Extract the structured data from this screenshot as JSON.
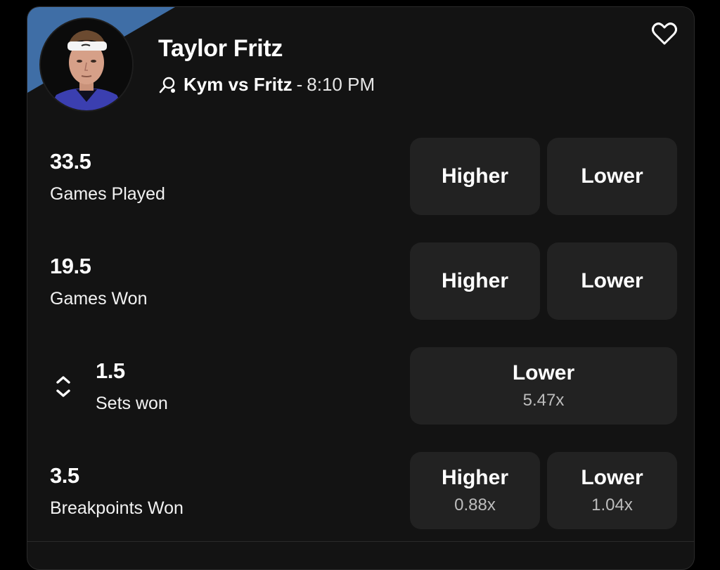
{
  "player": {
    "name": "Taylor Fritz",
    "matchup": "Kym vs Fritz",
    "separator": "-",
    "time": "8:10 PM"
  },
  "colors": {
    "card_bg": "#131313",
    "button_bg": "#222222",
    "accent_flag": "#3f6ea6",
    "text_primary": "#ffffff",
    "text_secondary": "#bdbdbd"
  },
  "icons": {
    "favorite": "heart-outline-icon",
    "match": "tennis-racket-icon",
    "toggle": "chevron-up-down-icon"
  },
  "props": [
    {
      "value": "33.5",
      "label": "Games Played",
      "higher": {
        "label": "Higher",
        "multiplier": ""
      },
      "lower": {
        "label": "Lower",
        "multiplier": ""
      }
    },
    {
      "value": "19.5",
      "label": "Games Won",
      "higher": {
        "label": "Higher",
        "multiplier": ""
      },
      "lower": {
        "label": "Lower",
        "multiplier": ""
      }
    },
    {
      "value": "1.5",
      "label": "Sets won",
      "lower": {
        "label": "Lower",
        "multiplier": "5.47x"
      }
    },
    {
      "value": "3.5",
      "label": "Breakpoints Won",
      "higher": {
        "label": "Higher",
        "multiplier": "0.88x"
      },
      "lower": {
        "label": "Lower",
        "multiplier": "1.04x"
      }
    }
  ]
}
